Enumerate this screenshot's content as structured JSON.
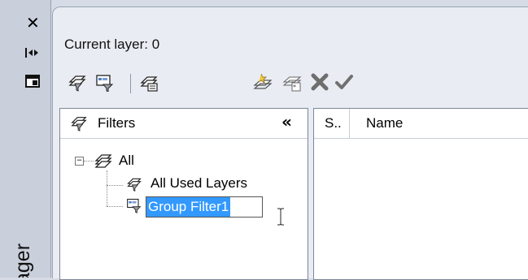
{
  "palette": {
    "vertical_title": "ager",
    "strip_icons": [
      "close-icon",
      "autohide-icon",
      "properties-icon"
    ]
  },
  "header": {
    "current_layer_label": "Current layer: 0"
  },
  "toolbar": {
    "left_icons": [
      "new-property-filter-icon",
      "new-group-filter-icon",
      "layer-states-manager-icon"
    ],
    "right_icons": [
      "new-layer-icon",
      "new-layer-vp-frozen-icon",
      "delete-layer-icon",
      "set-current-icon"
    ]
  },
  "filters": {
    "header_label": "Filters",
    "collapse_glyph": "«",
    "tree": {
      "root_label": "All",
      "children": [
        {
          "label": "All Used Layers"
        },
        {
          "label": "Group Filter1",
          "editing": true
        }
      ]
    }
  },
  "layer_list": {
    "columns": [
      {
        "label": "S.."
      },
      {
        "label": "Name"
      }
    ]
  },
  "colors": {
    "selection": "#3399ff",
    "panel_bg": "#e9edf3",
    "delete_icon": "#6e6e6e"
  }
}
